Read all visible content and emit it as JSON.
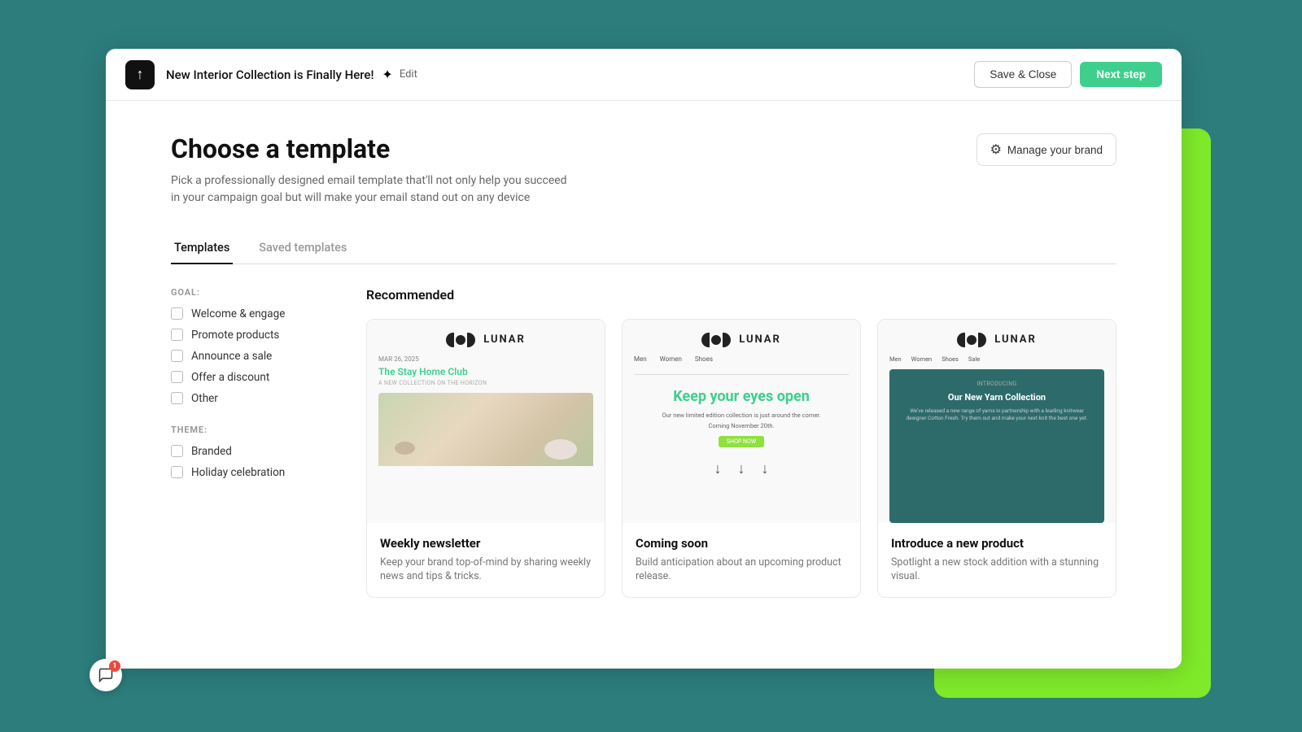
{
  "topbar": {
    "logo_text": "↑",
    "campaign_title": "New Interior Collection is Finally Here!",
    "sparkle": "✦",
    "edit_label": "Edit",
    "save_close_label": "Save & Close",
    "next_step_label": "Next step"
  },
  "page": {
    "heading": "Choose a template",
    "description": "Pick a professionally designed email template that'll not only help you succeed in your campaign goal but will make your email stand out on any device"
  },
  "manage_brand": {
    "label": "Manage your brand"
  },
  "tabs": [
    {
      "id": "templates",
      "label": "Templates",
      "active": true
    },
    {
      "id": "saved-templates",
      "label": "Saved templates",
      "active": false
    }
  ],
  "filters": {
    "goal_label": "GOAL:",
    "goal_items": [
      {
        "id": "welcome",
        "label": "Welcome & engage"
      },
      {
        "id": "promote",
        "label": "Promote products"
      },
      {
        "id": "sale",
        "label": "Announce a sale"
      },
      {
        "id": "discount",
        "label": "Offer a discount"
      },
      {
        "id": "other",
        "label": "Other"
      }
    ],
    "theme_label": "THEME:",
    "theme_items": [
      {
        "id": "branded",
        "label": "Branded"
      },
      {
        "id": "holiday",
        "label": "Holiday celebration"
      }
    ]
  },
  "recommended": {
    "section_title": "Recommended",
    "templates": [
      {
        "id": "weekly-newsletter",
        "name": "Weekly newsletter",
        "description": "Keep your brand top-of-mind by sharing weekly news and tips & tricks.",
        "preview": {
          "brand_name": "LUNAR",
          "date": "MAR 26, 2025",
          "club_name": "The Stay Home Club",
          "subtitle": "A NEW COLLECTION ON THE HORIZON"
        }
      },
      {
        "id": "coming-soon",
        "name": "Coming soon",
        "description": "Build anticipation about an upcoming product release.",
        "preview": {
          "brand_name": "LUNAR",
          "nav_items": [
            "Men",
            "Women",
            "Shoes"
          ],
          "heading": "Keep your eyes open",
          "sub_text": "Our new limited edition collection is just around the corner.",
          "date_text": "Coming November 20th."
        }
      },
      {
        "id": "introduce-product",
        "name": "Introduce a new product",
        "description": "Spotlight a new stock addition with a stunning visual.",
        "preview": {
          "brand_name": "LUNAR",
          "nav_items": [
            "Men",
            "Women",
            "Shoes",
            "Sale"
          ],
          "intro_label": "Introducing",
          "hero_title": "Our New Yarn Collection",
          "hero_body": "We've released a new range of yarns in partnership with a leading knitwear designer Cotton Fresh. Try them out and make your next knit the best one yet."
        }
      }
    ]
  },
  "chat": {
    "badge": "1"
  }
}
